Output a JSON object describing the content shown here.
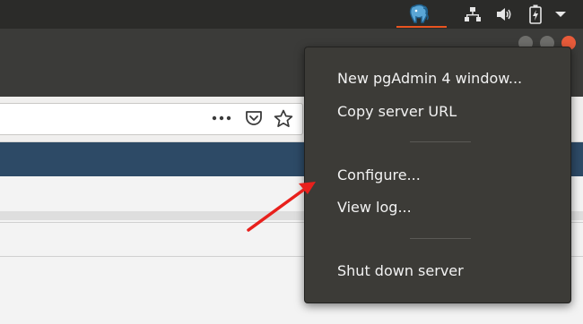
{
  "tray": {
    "active_app_icon": "pgadmin-elephant-icon",
    "network_icon": "network-icon",
    "volume_icon": "volume-icon",
    "battery_icon": "battery-charging-icon",
    "menu_icon": "chevron-down-icon",
    "accent_color": "#e95420"
  },
  "browser": {
    "url_action_icons": [
      "more-actions-icon",
      "pocket-icon",
      "bookmark-star-icon"
    ]
  },
  "menu": {
    "items": [
      {
        "label": "New pgAdmin 4 window..."
      },
      {
        "label": "Copy server URL"
      },
      {
        "label": "Configure..."
      },
      {
        "label": "View log..."
      },
      {
        "label": "Shut down server"
      }
    ],
    "background_color": "#3c3b37",
    "text_color": "#f2f2f2"
  },
  "annotation": {
    "arrow_color": "#e8201c"
  }
}
